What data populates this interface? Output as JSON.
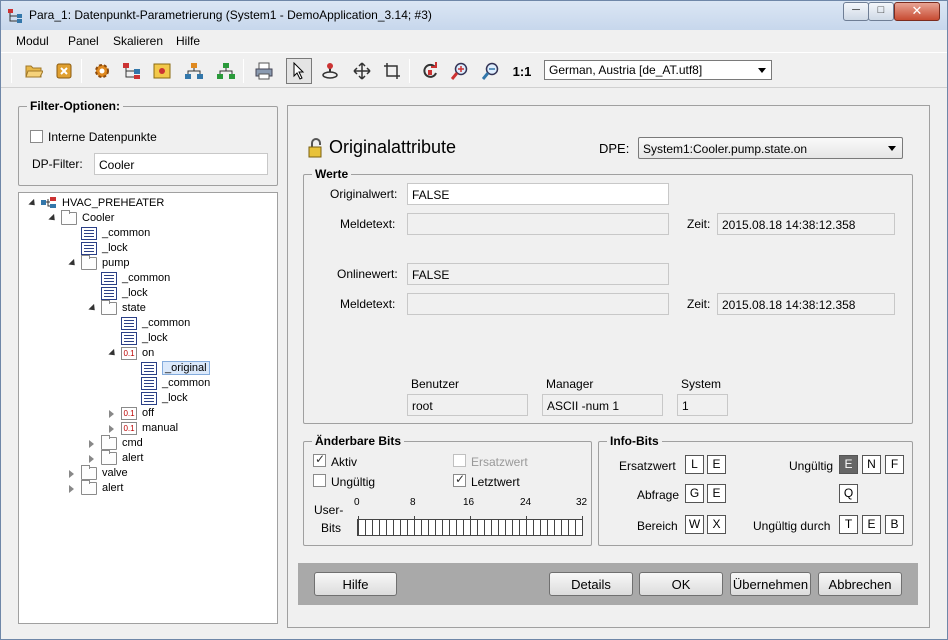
{
  "window": {
    "title": "Para_1: Datenpunkt-Parametrierung (System1 - DemoApplication_3.14; #3)",
    "minimize": "─",
    "maximize": "□",
    "close": "✕"
  },
  "menu": [
    "Modul",
    "Panel",
    "Skalieren",
    "Hilfe"
  ],
  "toolbar": {
    "zoom_label": "1:1",
    "language": "German, Austria [de_AT.utf8]",
    "tools": [
      "open-folder-icon",
      "close-module-icon",
      "settings-gear-icon",
      "tree-nodes-icon",
      "image-icon",
      "hierarchy-orange-icon",
      "hierarchy-green-icon",
      "print-icon",
      "pointer-icon",
      "tree-rotate-icon",
      "move-icon",
      "crop-icon",
      "refresh-icon",
      "zoom-in-icon",
      "zoom-out-icon"
    ]
  },
  "filter": {
    "title": "Filter-Optionen:",
    "internal_label": "Interne Datenpunkte",
    "internal_checked": false,
    "dp_filter_label": "DP-Filter:",
    "dp_filter_value": "Cooler"
  },
  "tree": [
    {
      "label": "HVAC_PREHEATER",
      "level": 0,
      "icon": "system",
      "state": "open"
    },
    {
      "label": "Cooler",
      "level": 1,
      "icon": "folder",
      "state": "open"
    },
    {
      "label": "_common",
      "level": 2,
      "icon": "config",
      "state": "none"
    },
    {
      "label": "_lock",
      "level": 2,
      "icon": "config",
      "state": "none"
    },
    {
      "label": "pump",
      "level": 2,
      "icon": "folder",
      "state": "open"
    },
    {
      "label": "_common",
      "level": 3,
      "icon": "config",
      "state": "none"
    },
    {
      "label": "_lock",
      "level": 3,
      "icon": "config",
      "state": "none"
    },
    {
      "label": "state",
      "level": 3,
      "icon": "folder",
      "state": "open"
    },
    {
      "label": "_common",
      "level": 4,
      "icon": "config",
      "state": "none"
    },
    {
      "label": "_lock",
      "level": 4,
      "icon": "config",
      "state": "none"
    },
    {
      "label": "on",
      "level": 4,
      "icon": "bool",
      "state": "open"
    },
    {
      "label": "_original",
      "level": 5,
      "icon": "config",
      "state": "none",
      "selected": true
    },
    {
      "label": "_common",
      "level": 5,
      "icon": "config",
      "state": "none"
    },
    {
      "label": "_lock",
      "level": 5,
      "icon": "config",
      "state": "none"
    },
    {
      "label": "off",
      "level": 4,
      "icon": "bool",
      "state": "closed"
    },
    {
      "label": "manual",
      "level": 4,
      "icon": "bool",
      "state": "closed"
    },
    {
      "label": "cmd",
      "level": 3,
      "icon": "folder",
      "state": "closed"
    },
    {
      "label": "alert",
      "level": 3,
      "icon": "folder",
      "state": "closed"
    },
    {
      "label": "valve",
      "level": 2,
      "icon": "folder",
      "state": "closed"
    },
    {
      "label": "alert",
      "level": 2,
      "icon": "folder",
      "state": "closed"
    }
  ],
  "bool_icon_text": "0.1",
  "panel": {
    "title": "Originalattribute",
    "dpe_label": "DPE:",
    "dpe_value": "System1:Cooler.pump.state.on"
  },
  "werte": {
    "title": "Werte",
    "originalwert_label": "Originalwert:",
    "originalwert_value": "FALSE",
    "meldetext_label": "Meldetext:",
    "meldetext_value": "",
    "zeit_label": "Zeit:",
    "zeit_value": "2015.08.18 14:38:12.358",
    "onlinewert_label": "Onlinewert:",
    "onlinewert_value": "FALSE",
    "meldetext2_label": "Meldetext:",
    "meldetext2_value": "",
    "zeit2_label": "Zeit:",
    "zeit2_value": "2015.08.18 14:38:12.358",
    "benutzer_label": "Benutzer",
    "benutzer_value": "root",
    "manager_label": "Manager",
    "manager_value": "ASCII -num 1",
    "system_label": "System",
    "system_value": "1"
  },
  "bits": {
    "title": "Änderbare Bits",
    "aktiv_label": "Aktiv",
    "aktiv_checked": true,
    "ersatzwert_label": "Ersatzwert",
    "ersatzwert_checked": false,
    "ungueltig_label": "Ungültig",
    "ungueltig_checked": false,
    "letztwert_label": "Letztwert",
    "letztwert_checked": true,
    "user_bits_label_1": "User-",
    "user_bits_label_2": "Bits",
    "scale": [
      "0",
      "8",
      "16",
      "24",
      "32"
    ]
  },
  "info": {
    "title": "Info-Bits",
    "ersatzwert_label": "Ersatzwert",
    "ersatzwert_bits": [
      "L",
      "E"
    ],
    "abfrage_label": "Abfrage",
    "abfrage_bits": [
      "G",
      "E"
    ],
    "bereich_label": "Bereich",
    "bereich_bits": [
      "W",
      "X"
    ],
    "ungueltig_label": "Ungültig",
    "ungueltig_bits": [
      "E",
      "N",
      "F"
    ],
    "q_bit": "Q",
    "ungueltig_durch_label": "Ungültig durch",
    "ungueltig_durch_bits": [
      "T",
      "E",
      "B"
    ]
  },
  "buttons": {
    "hilfe": "Hilfe",
    "details": "Details",
    "ok": "OK",
    "uebernehmen": "Übernehmen",
    "abbrechen": "Abbrechen"
  }
}
